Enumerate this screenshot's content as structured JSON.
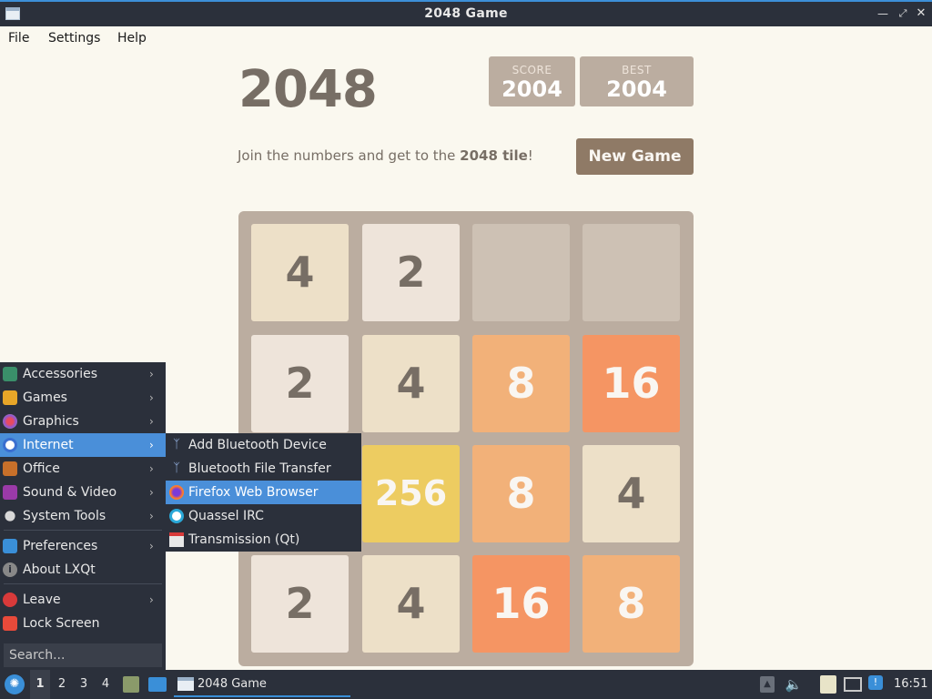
{
  "window": {
    "title": "2048 Game"
  },
  "menubar": {
    "file": "File",
    "settings": "Settings",
    "help": "Help"
  },
  "game": {
    "title": "2048",
    "score_label": "SCORE",
    "score": "2004",
    "best_label": "BEST",
    "best": "2004",
    "intro_prefix": "Join the numbers and get to the ",
    "intro_bold": "2048 tile",
    "intro_suffix": "!",
    "new_game": "New Game",
    "grid": [
      [
        "4",
        "2",
        "",
        ""
      ],
      [
        "2",
        "4",
        "8",
        "16"
      ],
      [
        "",
        "256",
        "8",
        "4"
      ],
      [
        "2",
        "4",
        "16",
        "8"
      ]
    ]
  },
  "main_menu": {
    "items": [
      {
        "label": "Accessories",
        "icon": "accessories-icon",
        "submenu": true
      },
      {
        "label": "Games",
        "icon": "games-icon",
        "submenu": true
      },
      {
        "label": "Graphics",
        "icon": "graphics-icon",
        "submenu": true
      },
      {
        "label": "Internet",
        "icon": "internet-icon",
        "submenu": true,
        "selected": true
      },
      {
        "label": "Office",
        "icon": "office-icon",
        "submenu": true
      },
      {
        "label": "Sound & Video",
        "icon": "sound-video-icon",
        "submenu": true
      },
      {
        "label": "System Tools",
        "icon": "system-tools-icon",
        "submenu": true
      },
      {
        "label": "Preferences",
        "icon": "preferences-icon",
        "submenu": true
      },
      {
        "label": "About LXQt",
        "icon": "info-icon",
        "submenu": false
      },
      {
        "label": "Leave",
        "icon": "power-icon",
        "submenu": true
      },
      {
        "label": "Lock Screen",
        "icon": "lock-icon",
        "submenu": false
      }
    ],
    "search_placeholder": "Search..."
  },
  "internet_submenu": {
    "items": [
      {
        "label": "Add Bluetooth Device",
        "icon": "bluetooth-icon"
      },
      {
        "label": "Bluetooth File Transfer",
        "icon": "bluetooth-icon"
      },
      {
        "label": "Firefox Web Browser",
        "icon": "firefox-icon",
        "selected": true
      },
      {
        "label": "Quassel IRC",
        "icon": "quassel-icon"
      },
      {
        "label": "Transmission (Qt)",
        "icon": "transmission-icon"
      }
    ]
  },
  "taskbar": {
    "workspaces": [
      "1",
      "2",
      "3",
      "4"
    ],
    "task_title": "2048 Game",
    "clock": "16:51"
  },
  "colors": {
    "tile_2": "#eee4da",
    "tile_4": "#ede0c8",
    "tile_8": "#f2b179",
    "tile_16": "#f59563",
    "tile_256": "#edcc61",
    "board": "#bbada0",
    "empty_cell": "#cdc1b4",
    "accent": "#4a8fd9"
  }
}
